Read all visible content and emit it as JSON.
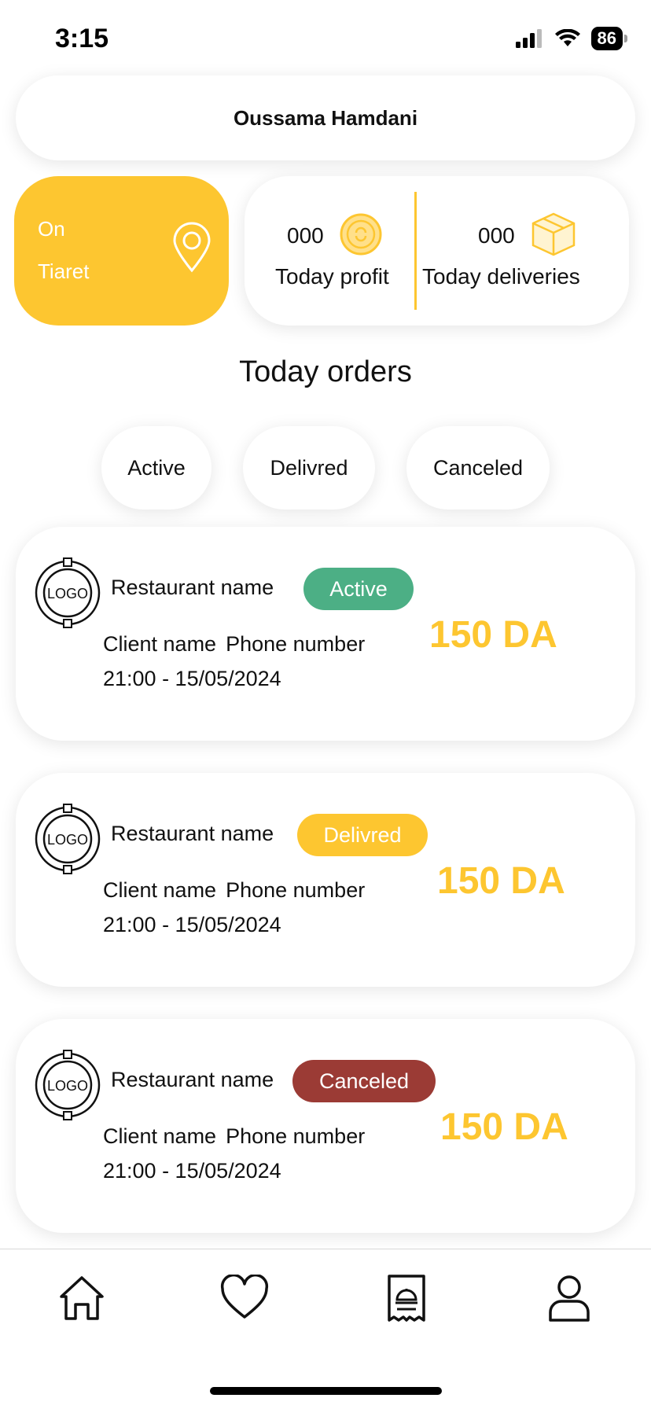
{
  "status_bar": {
    "time": "3:15",
    "battery": "86"
  },
  "header": {
    "user_name": "Oussama Hamdani"
  },
  "location": {
    "line1": "On",
    "line2": "Tiaret",
    "icon": "map-pin-icon"
  },
  "stats": {
    "profit": {
      "value": "000",
      "label": "Today profit",
      "icon": "coin-icon"
    },
    "deliveries": {
      "value": "000",
      "label": "Today deliveries",
      "icon": "box-icon"
    }
  },
  "section_title": "Today orders",
  "filters": [
    {
      "label": "Active"
    },
    {
      "label": "Delivred"
    },
    {
      "label": "Canceled"
    }
  ],
  "orders": [
    {
      "logo_text": "LOGO",
      "restaurant": "Restaurant name",
      "status": "Active",
      "status_color": "#4CAF85",
      "client": "Client name",
      "phone": "Phone number",
      "datetime": "21:00 - 15/05/2024",
      "price": "150 DA"
    },
    {
      "logo_text": "LOGO",
      "restaurant": "Restaurant name",
      "status": "Delivred",
      "status_color": "#FDC630",
      "client": "Client name",
      "phone": "Phone number",
      "datetime": "21:00 - 15/05/2024",
      "price": "150 DA"
    },
    {
      "logo_text": "LOGO",
      "restaurant": "Restaurant name",
      "status": "Canceled",
      "status_color": "#9B3B35",
      "client": "Client name",
      "phone": "Phone number",
      "datetime": "21:00 - 15/05/2024",
      "price": "150 DA"
    }
  ],
  "bottom_nav": [
    {
      "icon": "home-icon"
    },
    {
      "icon": "heart-icon"
    },
    {
      "icon": "orders-receipt-icon"
    },
    {
      "icon": "profile-icon"
    }
  ],
  "colors": {
    "accent": "#FDC630",
    "active": "#4CAF85",
    "canceled": "#9B3B35"
  }
}
